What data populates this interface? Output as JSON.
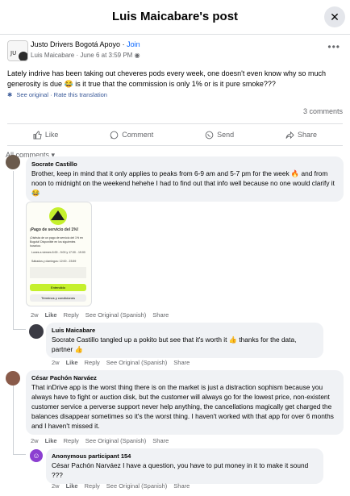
{
  "header": {
    "title": "Luis Maicabare's post",
    "close_icon": "close-icon"
  },
  "post": {
    "group": "Justo Drivers Bogotá Apoyo",
    "join": "Join",
    "author": "Luis Maicabare",
    "date": "June 6 at 3:59 PM",
    "sep1": "·",
    "sep2": "·",
    "text": "Lately indrive has been taking out cheveres pods every week, one doesn't even know why so much generosity is due 😂 is it true that the commission is only 1% or is it pure smoke???",
    "see_original": "See original",
    "rate_translation": "Rate this translation",
    "comments_count": "3 comments"
  },
  "actions": {
    "like": "Like",
    "comment": "Comment",
    "send": "Send",
    "share": "Share"
  },
  "filter": {
    "label": "All comments"
  },
  "attachment": {
    "title": "¡Pago de servicio del 1%!",
    "body": "¡Disfruta de un pago de servicio del 1% en Bogotá! Disponible en los siguientes horarios:",
    "line1": "Lunes a viernes 6:00 - 9:00 y 17:00 - 19:00",
    "line2": "Sábados y domingos: 12:00 - 23:59",
    "cta": "Entendido",
    "footer": "Términos y condiciones"
  },
  "comments": [
    {
      "name": "Socrate Castillo",
      "text": "Brother, keep in mind that it only applies to peaks from 6-9 am and 5-7 pm for the week 🔥 and from noon to midnight on the weekend hehehe I had to find out that info well because no one would clarify it 😂",
      "time": "2w",
      "like": "Like",
      "reply": "Reply",
      "see_original": "See Original (Spanish)",
      "share": "Share"
    },
    {
      "name": "Luis Maicabare",
      "text": "Socrate Castillo tangled up a pokito but see that it's worth it 👍 thanks for the data, partner 👍",
      "time": "2w",
      "like": "Like",
      "reply": "Reply",
      "see_original": "See Original (Spanish)",
      "share": "Share"
    },
    {
      "name": "César Pachón Narváez",
      "text": "That inDrive app is the worst thing there is on the market is just a distraction sophism because you always have to fight or auction disk, but the customer will always go for the lowest price, non-existent customer service a perverse support never help anything, the cancellations magically get charged the balances disappear sometimes so it's the worst thing. I haven't worked with that app for over 6 months and I haven't missed it.",
      "time": "2w",
      "like": "Like",
      "reply": "Reply",
      "see_original": "See Original (Spanish)",
      "share": "Share"
    },
    {
      "name": "Anonymous participant 154",
      "text": "César Pachón Narváez I have a question, you have to put money in it to make it sound ???",
      "time": "2w",
      "like": "Like",
      "reply": "Reply",
      "see_original": "See Original (Spanish)",
      "share": "Share"
    }
  ]
}
